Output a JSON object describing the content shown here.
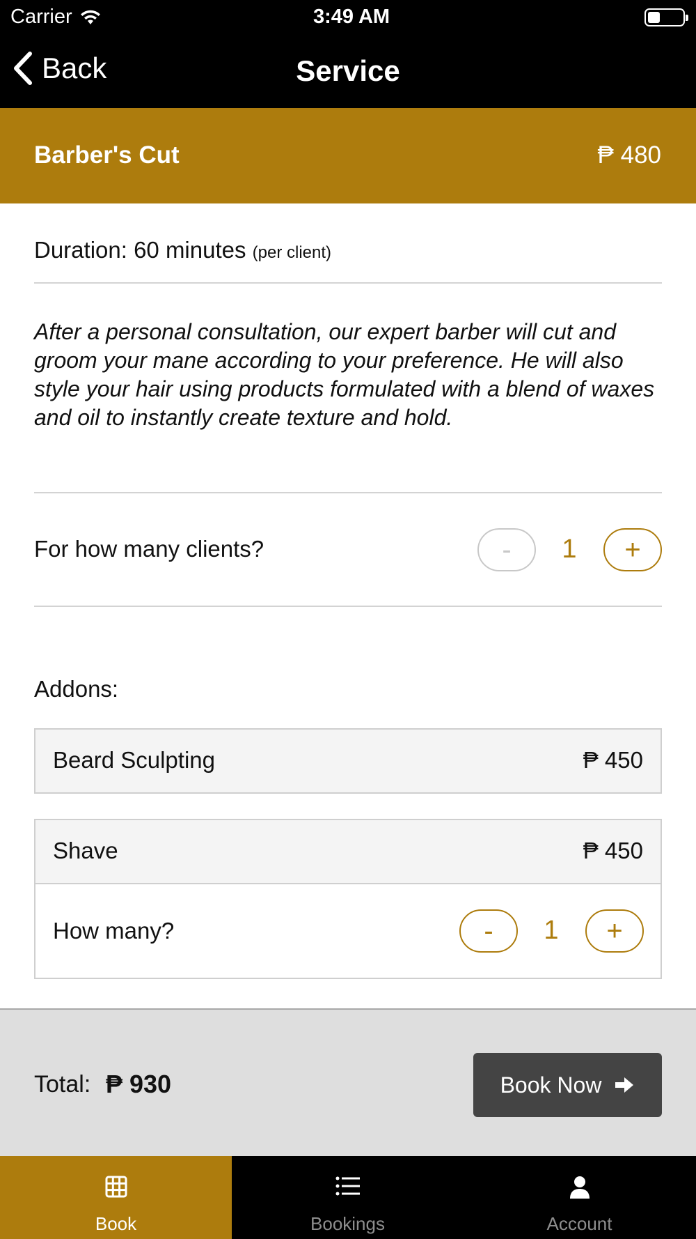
{
  "status_bar": {
    "carrier": "Carrier",
    "time": "3:49 AM",
    "battery_level": 0.35
  },
  "nav": {
    "back_label": "Back",
    "title": "Service"
  },
  "service": {
    "name": "Barber's Cut",
    "price": "₱ 480"
  },
  "duration": {
    "text": "Duration: 60 minutes",
    "note": "(per client)"
  },
  "description": "After a personal consultation, our expert barber will cut and groom your mane according to your preference.  He will also style your hair using products formulated with a blend of waxes and oil to instantly create texture and hold.",
  "clients": {
    "label": "For how many clients?",
    "minus": "-",
    "value": "1",
    "plus": "+"
  },
  "addons": {
    "label": "Addons:",
    "items": [
      {
        "name": "Beard Sculpting",
        "price": "₱ 450"
      },
      {
        "name": "Shave",
        "price": "₱ 450",
        "qty_label": "How many?",
        "minus": "-",
        "qty": "1",
        "plus": "+"
      }
    ]
  },
  "footer": {
    "total_label": "Total:",
    "total_value": "₱ 930",
    "book_label": "Book Now"
  },
  "tabs": [
    {
      "label": "Book",
      "icon": "grid-icon",
      "active": true
    },
    {
      "label": "Bookings",
      "icon": "list-icon",
      "active": false
    },
    {
      "label": "Account",
      "icon": "person-icon",
      "active": false
    }
  ],
  "colors": {
    "accent": "#ad7c0d",
    "bar": "#000000",
    "button": "#444444"
  }
}
